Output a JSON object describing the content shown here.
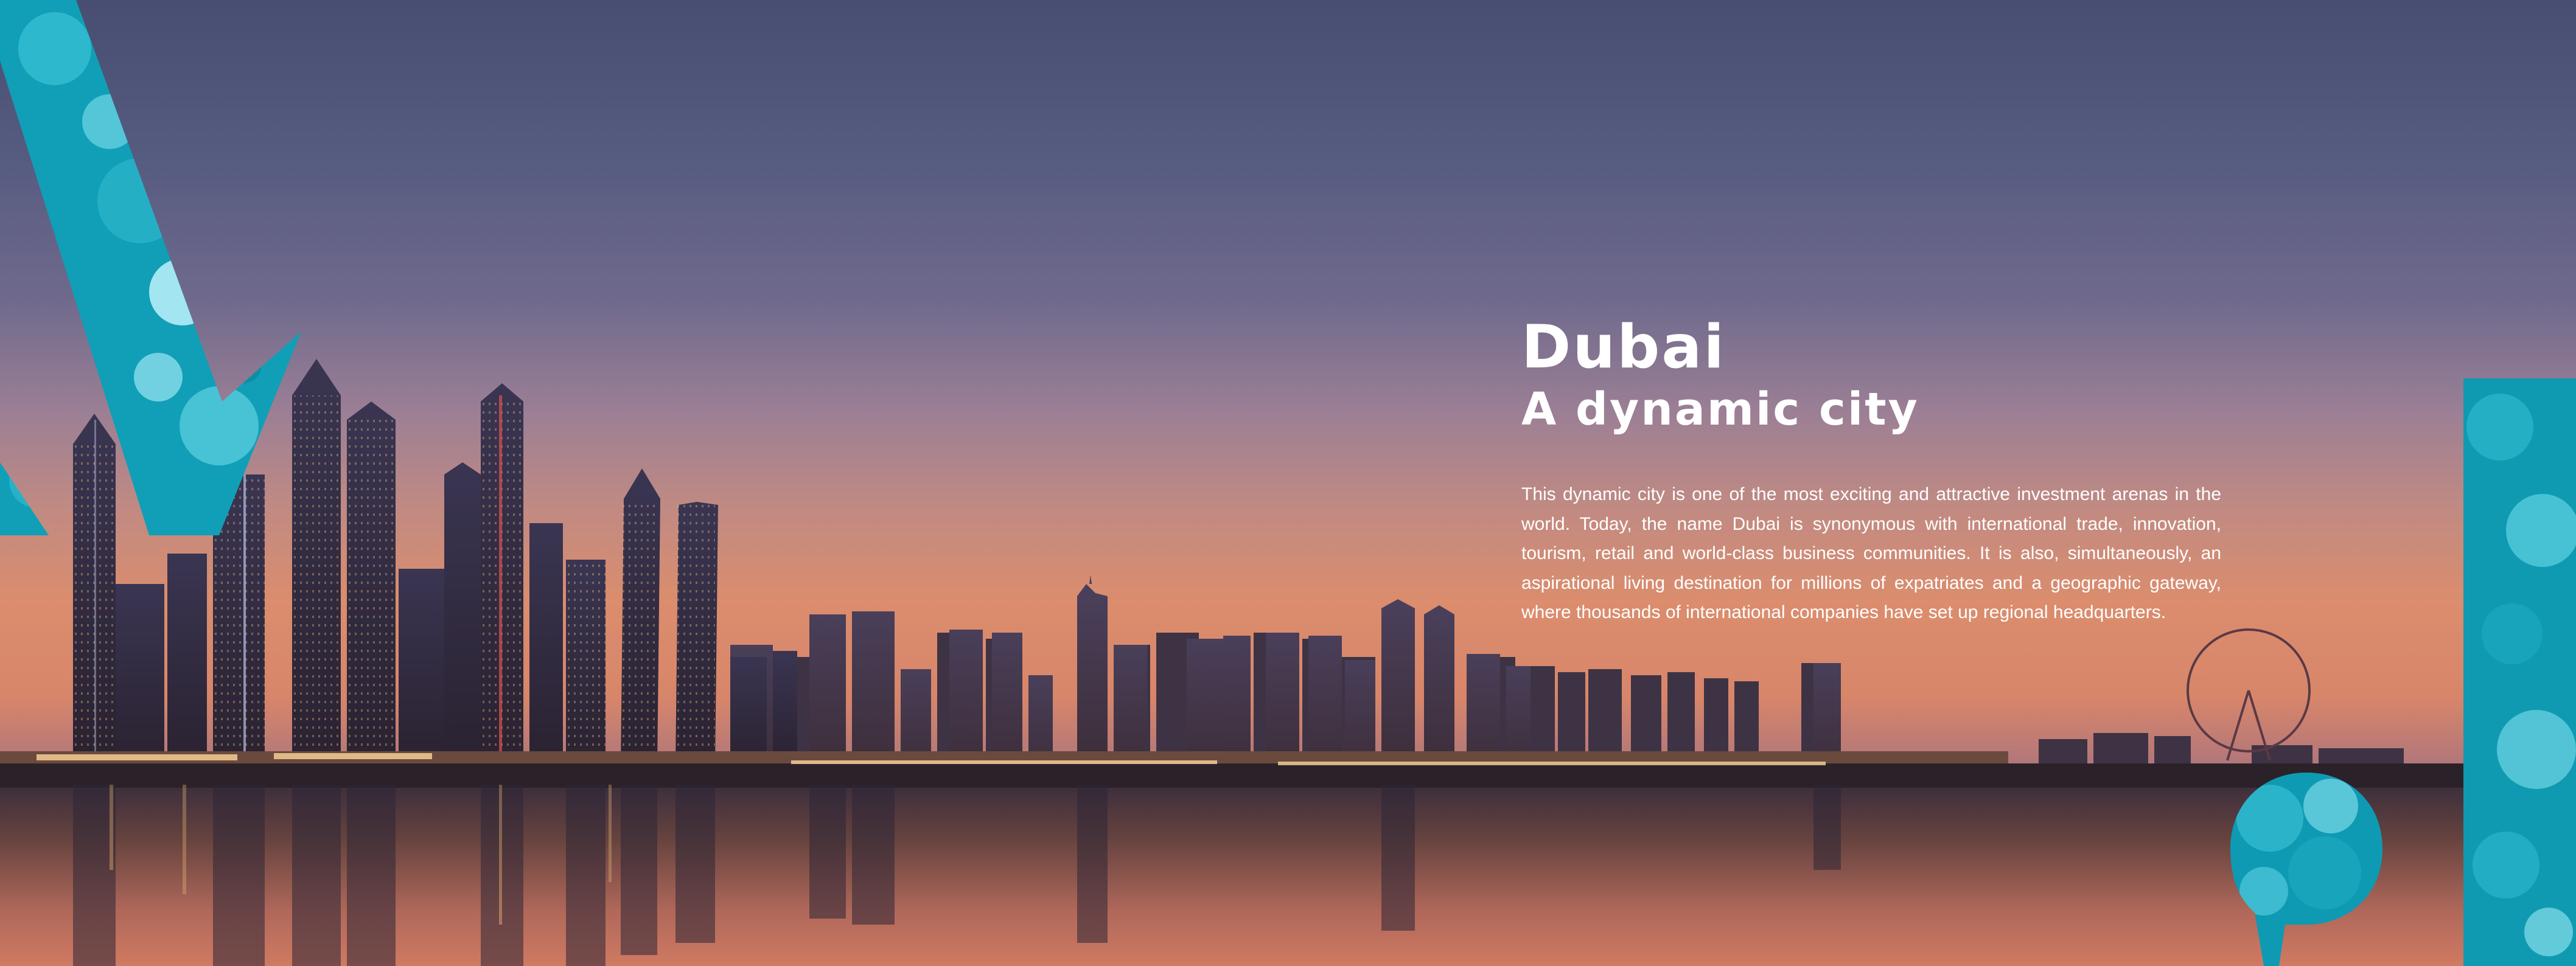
{
  "hero": {
    "title": "Dubai",
    "subtitle": "A dynamic city",
    "body": "This dynamic city is one of the most exciting and attractive investment arenas in the world. Today, the name Dubai is synonymous with international trade, innovation, tourism, retail and world-class business communities. It is also, simultaneously, an aspirational living destination for millions of expatriates and a geographic gateway, where thousands of international companies have set up regional headquarters."
  },
  "colors": {
    "accent_teal": "#13acc2",
    "text": "#ffffff",
    "sky_top": "#474e71",
    "sky_horizon": "#db8d6d"
  },
  "graphics": {
    "left_shape": "teal-chevron-bokeh",
    "right_shape": "teal-bar-bokeh",
    "bottom_shape": "teal-quote-mark-bokeh",
    "background": "dubai-marina-skyline-dusk-photo",
    "landmark": "ferris-wheel"
  }
}
